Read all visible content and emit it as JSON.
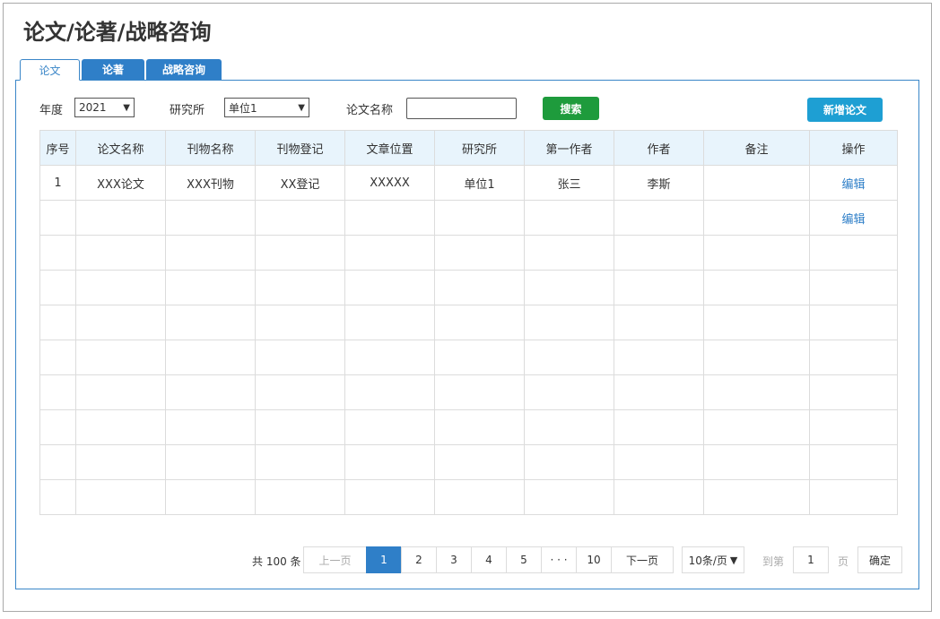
{
  "page": {
    "title": "论文/论著/战略咨询"
  },
  "tabs": [
    {
      "label": "论文",
      "active": true
    },
    {
      "label": "论著",
      "active": false
    },
    {
      "label": "战略咨询",
      "active": false
    }
  ],
  "filters": {
    "year_label": "年度",
    "year_value": "2021",
    "institute_label": "研究所",
    "institute_value": "单位1",
    "paper_name_label": "论文名称",
    "paper_name_value": "",
    "search_button": "搜索",
    "add_button": "新增论文"
  },
  "table": {
    "headers": [
      "序号",
      "论文名称",
      "刊物名称",
      "刊物登记",
      "文章位置",
      "研究所",
      "第一作者",
      "作者",
      "备注",
      "操作"
    ],
    "rows": [
      [
        "1",
        "XXX论文",
        "XXX刊物",
        "XX登记",
        "XXXXX",
        "单位1",
        "张三",
        "李斯",
        "",
        "编辑"
      ],
      [
        "",
        "",
        "",
        "",
        "",
        "",
        "",
        "",
        "",
        "编辑"
      ],
      [
        "",
        "",
        "",
        "",
        "",
        "",
        "",
        "",
        "",
        ""
      ],
      [
        "",
        "",
        "",
        "",
        "",
        "",
        "",
        "",
        "",
        ""
      ],
      [
        "",
        "",
        "",
        "",
        "",
        "",
        "",
        "",
        "",
        ""
      ],
      [
        "",
        "",
        "",
        "",
        "",
        "",
        "",
        "",
        "",
        ""
      ],
      [
        "",
        "",
        "",
        "",
        "",
        "",
        "",
        "",
        "",
        ""
      ],
      [
        "",
        "",
        "",
        "",
        "",
        "",
        "",
        "",
        "",
        ""
      ],
      [
        "",
        "",
        "",
        "",
        "",
        "",
        "",
        "",
        "",
        ""
      ],
      [
        "",
        "",
        "",
        "",
        "",
        "",
        "",
        "",
        "",
        ""
      ]
    ]
  },
  "pagination": {
    "total": "共 100 条",
    "prev": "上一页",
    "pages": [
      "1",
      "2",
      "3",
      "4",
      "5",
      "· · ·",
      "10"
    ],
    "current": "1",
    "next": "下一页",
    "page_size": "10条/页",
    "goto_label": "到第",
    "goto_value": "1",
    "page_unit": "页",
    "confirm": "确定"
  },
  "colors": {
    "accent": "#2f7fc8",
    "search": "#1e9b3c",
    "add": "#1e9fd3"
  }
}
